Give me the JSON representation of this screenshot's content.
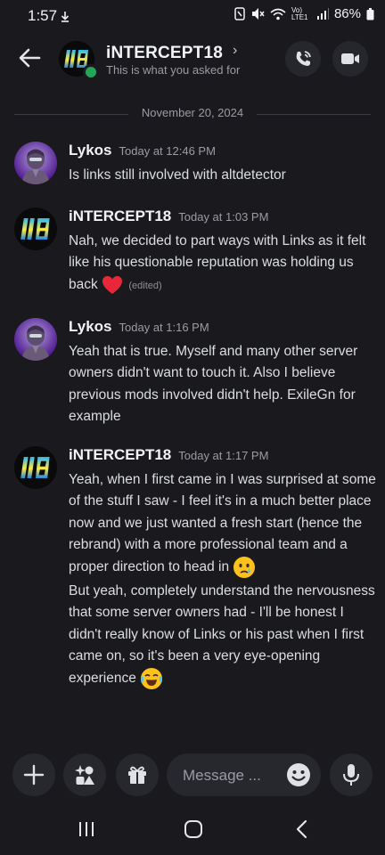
{
  "status_bar": {
    "time": "1:57",
    "network": "Vo) LTE1",
    "battery": "86%"
  },
  "header": {
    "title": "iNTERCEPT18",
    "subtitle": "This is what you asked for"
  },
  "divider": {
    "date": "November 20, 2024"
  },
  "messages": [
    {
      "author": "Lykos",
      "timestamp": "Today at 12:46 PM",
      "paragraphs": [
        "Is links still involved with altdetector"
      ]
    },
    {
      "author": "iNTERCEPT18",
      "timestamp": "Today at 1:03 PM",
      "paragraphs": [
        "Nah, we decided to part ways with Links as it felt like his questionable reputation was holding us back"
      ],
      "edited": "(edited)"
    },
    {
      "author": "Lykos",
      "timestamp": "Today at 1:16 PM",
      "paragraphs": [
        "Yeah that is true. Myself and many other server owners didn't want to touch it. Also I believe previous mods involved didn't help. ExileGn for example"
      ]
    },
    {
      "author": "iNTERCEPT18",
      "timestamp": "Today at 1:17 PM",
      "paragraphs": [
        "Yeah, when I first came in I was surprised at some of the stuff I saw - I feel it's in a much better place now and we just wanted a fresh start (hence the rebrand) with a more professional team and a proper direction to head in",
        "But yeah, completely understand the nervousness that some server owners had - I'll be honest I didn't really know of Links or his past when I first came on, so it's been a very eye-opening experience"
      ]
    }
  ],
  "composer": {
    "placeholder": "Message ..."
  },
  "icons": {
    "header": [
      "back-arrow-icon",
      "voice-call-icon",
      "video-call-icon"
    ],
    "composer": [
      "plus-icon",
      "apps-icon",
      "gift-icon",
      "emoji-icon",
      "microphone-icon"
    ],
    "navbar": [
      "recents-icon",
      "home-icon",
      "back-icon"
    ],
    "emoji_in_messages": [
      "red-heart",
      "sad-face-tear",
      "tears-of-joy"
    ]
  },
  "colors": {
    "background": "#1a1a1e",
    "online": "#23a55a",
    "heart": "#e8283a"
  }
}
